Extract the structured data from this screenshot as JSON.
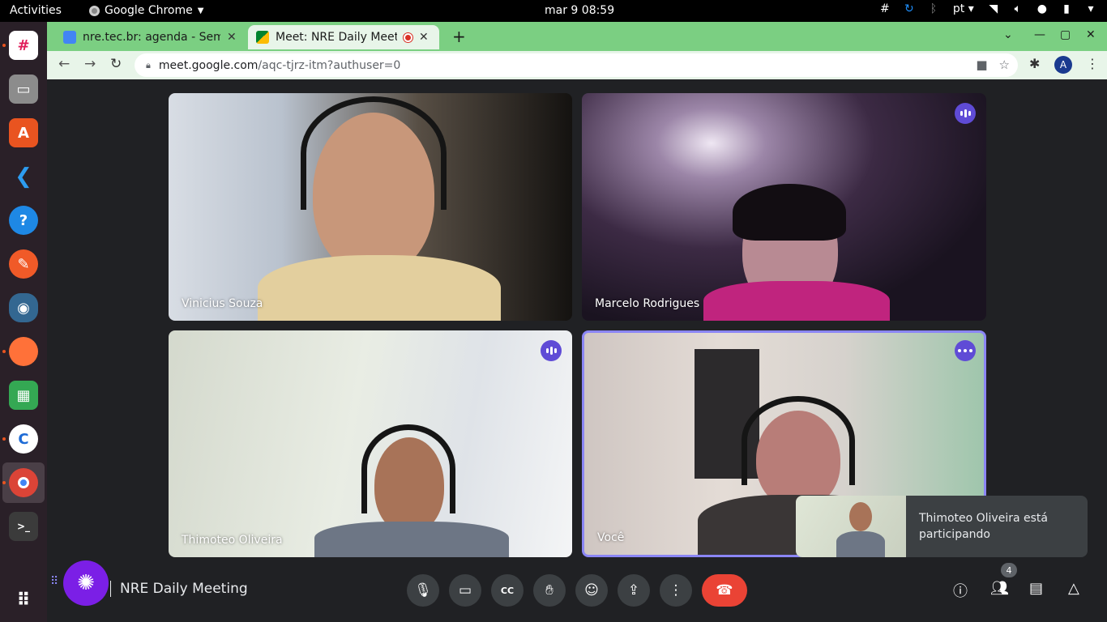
{
  "topbar": {
    "activities": "Activities",
    "app_name": "Google Chrome",
    "clock": "mar 9  08:59",
    "lang": "pt"
  },
  "browser": {
    "tabs": [
      {
        "title": "nre.tec.br: agenda - Semana",
        "favicon": "calendar-icon"
      },
      {
        "title": "Meet: NRE Daily Meeting",
        "favicon": "meet-icon"
      }
    ],
    "url_host": "meet.google.com",
    "url_path": "/aqc-tjrz-itm?authuser=0",
    "profile_initial": "A"
  },
  "meet": {
    "participants": [
      {
        "name": "Vinicius Souza"
      },
      {
        "name": "Marcelo Rodrigues"
      },
      {
        "name": "Thimoteo Oliveira"
      },
      {
        "name": "Você"
      }
    ],
    "toast": "Thimoteo Oliveira está participando",
    "meeting_name": "NRE Daily Meeting",
    "people_count": "4"
  },
  "colors": {
    "accent": "#5f4bd6",
    "end_call": "#ea4335",
    "chrome_frame": "#7bcf82"
  }
}
